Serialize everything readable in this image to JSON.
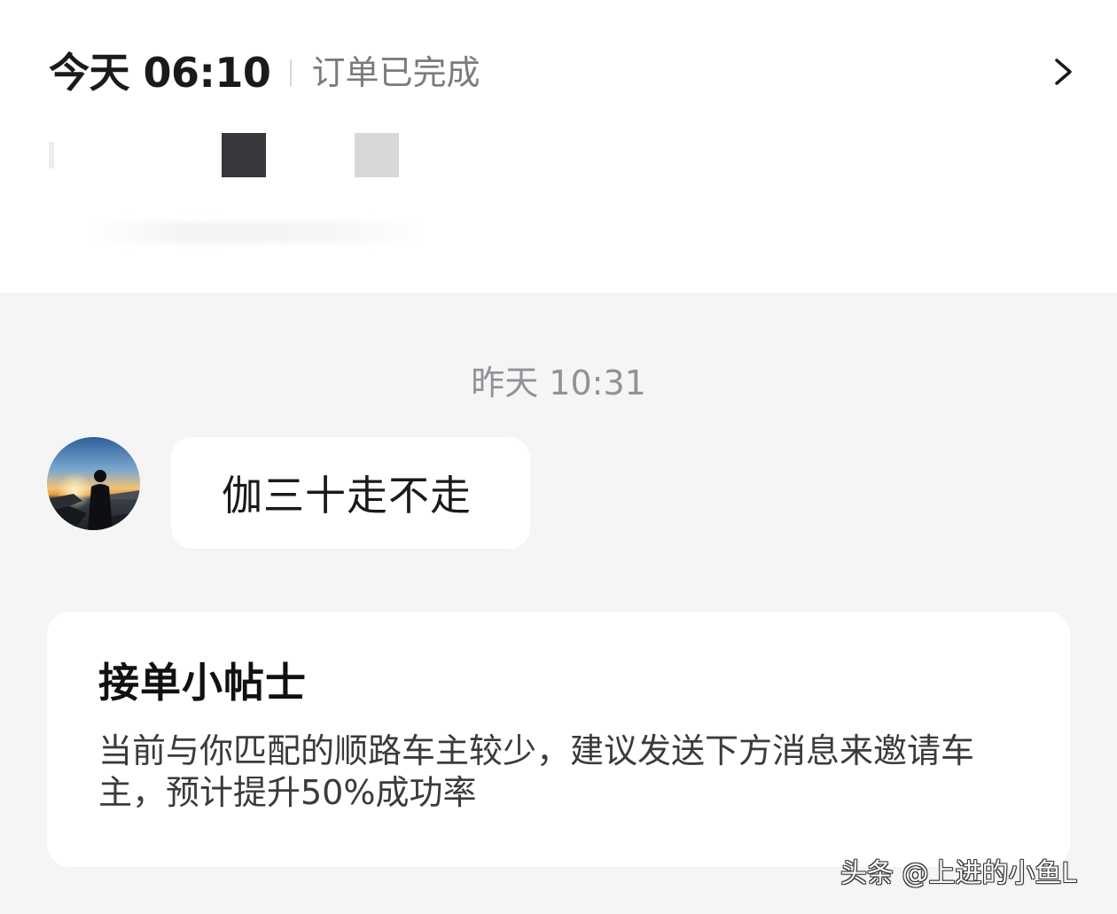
{
  "order": {
    "time": "今天 06:10",
    "status": "订单已完成",
    "chevron_icon": "chevron-right-icon"
  },
  "chat": {
    "timestamp": "昨天  10:31",
    "avatar_icon": "user-avatar-sunset",
    "message": "伽三十走不走"
  },
  "tips": {
    "title": "接单小帖士",
    "body": "当前与你匹配的顺路车主较少，建议发送下方消息来邀请车主，预计提升50%成功率"
  },
  "watermark": "头条 @上进的小鱼L"
}
